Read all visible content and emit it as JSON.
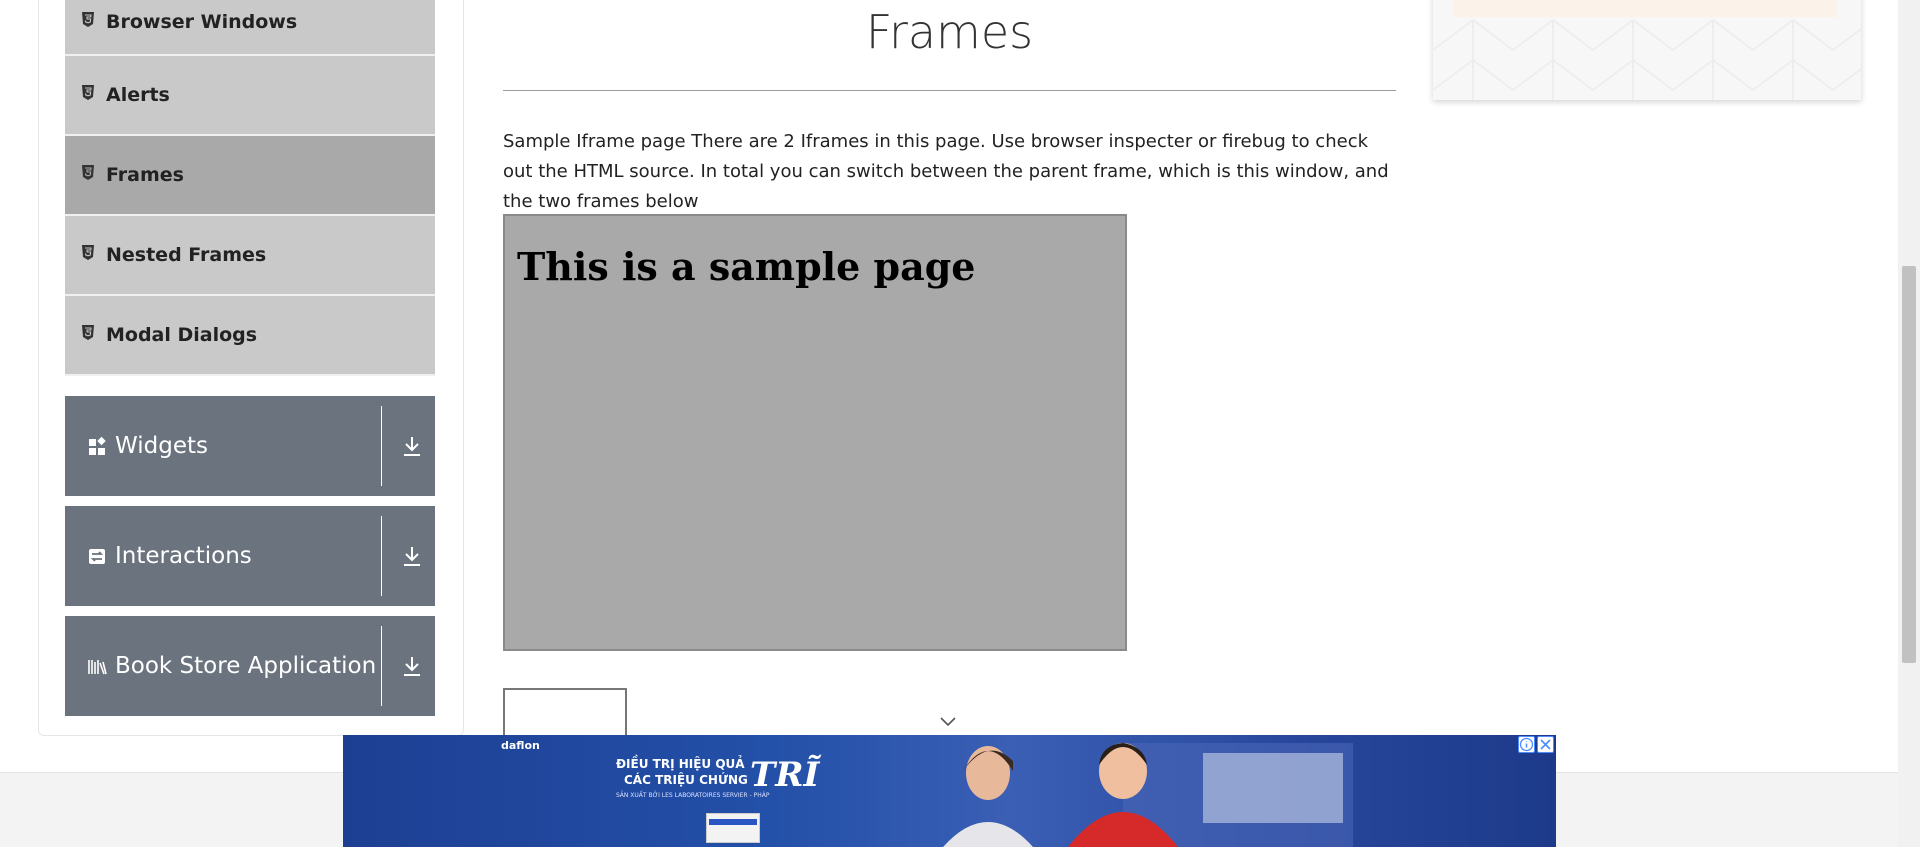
{
  "sidebar": {
    "sub_items": [
      {
        "label": "Browser Windows",
        "icon": "html5-icon"
      },
      {
        "label": "Alerts",
        "icon": "html5-icon"
      },
      {
        "label": "Frames",
        "icon": "html5-icon",
        "active": true
      },
      {
        "label": "Nested Frames",
        "icon": "html5-icon"
      },
      {
        "label": "Modal Dialogs",
        "icon": "html5-icon"
      }
    ],
    "groups": [
      {
        "label": "Widgets",
        "icon": "widgets-icon"
      },
      {
        "label": "Interactions",
        "icon": "interactions-icon"
      },
      {
        "label": "Book Store Application",
        "icon": "bookstore-icon"
      }
    ]
  },
  "main": {
    "title": "Frames",
    "description": "Sample Iframe page There are 2 Iframes in this page. Use browser inspecter or firebug to check out the HTML source. In total you can switch between the parent frame, which is this window, and the two frames below",
    "frame1_heading": "This is a sample page"
  },
  "banner": {
    "brand": "daflon",
    "line1": "ĐIỀU TRỊ HIỆU QUẢ",
    "line2": "CÁC TRIỆU CHỨNG",
    "tri": "TRĨ",
    "small": "SẢN XUẤT BỞI LES LABORATOIRES SERVIER - PHÁP"
  },
  "colors": {
    "sidebar_item": "#c9c9c9",
    "sidebar_active": "#a9a9a9",
    "group_bg": "#6b737e",
    "frame_bg": "#a9a9a9",
    "banner_bg": "#2350a8"
  }
}
